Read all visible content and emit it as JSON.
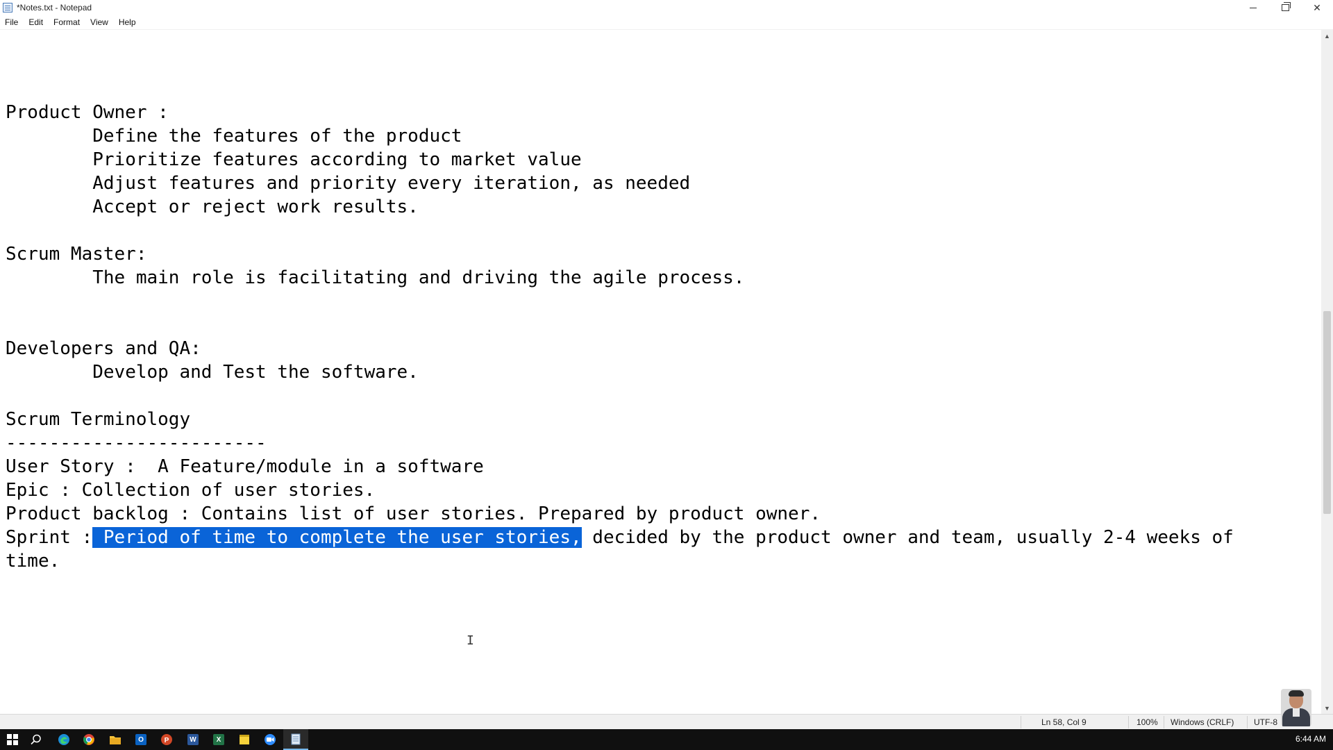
{
  "window": {
    "title": "*Notes.txt - Notepad"
  },
  "menu": {
    "items": [
      "File",
      "Edit",
      "Format",
      "View",
      "Help"
    ]
  },
  "editor": {
    "lines_before": "Product Owner :\n\tDefine the features of the product\n\tPrioritize features according to market value\n\tAdjust features and priority every iteration, as needed\n\tAccept or reject work results.\n\nScrum Master:\n\tThe main role is facilitating and driving the agile process.\n\n\nDevelopers and QA:\n\tDevelop and Test the software.\n\nScrum Terminology\n------------------------\nUser Story :  A Feature/module in a software\nEpic : Collection of user stories.\nProduct backlog : Contains list of user stories. Prepared by product owner.\nSprint :",
    "selected_text": " Period of time to complete the user stories,",
    "lines_after": " decided by the product owner and team, usually 2-4 weeks of\ntime."
  },
  "statusbar": {
    "position": "Ln 58, Col 9",
    "zoom": "100%",
    "line_ending": "Windows (CRLF)",
    "encoding": "UTF-8"
  },
  "taskbar": {
    "time": "6:44 AM",
    "icons": [
      "windows-start",
      "search",
      "edge",
      "chrome",
      "file-explorer",
      "outlook",
      "powerpoint",
      "word",
      "excel",
      "sticky-notes",
      "zoom",
      "notepad"
    ]
  },
  "colors": {
    "selection": "#0a64d8",
    "taskbar": "#101010",
    "statusbar": "#f0f0f0"
  }
}
